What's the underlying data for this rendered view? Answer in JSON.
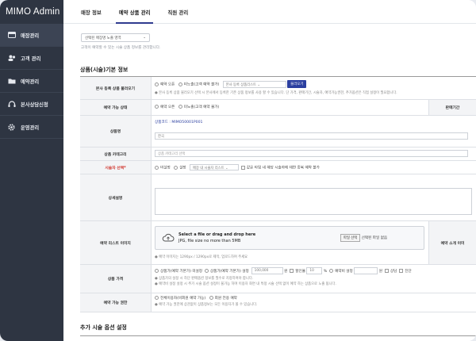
{
  "app": {
    "logo": "MIMO Admin"
  },
  "sidebar": {
    "items": [
      {
        "label": "매장관리",
        "icon": "store-icon",
        "active": true
      },
      {
        "label": "고객 관리",
        "icon": "users-icon"
      },
      {
        "label": "예약관리",
        "icon": "folder-icon"
      },
      {
        "label": "본사상담신청",
        "icon": "headset-icon"
      },
      {
        "label": "운영관리",
        "icon": "gear-icon"
      }
    ]
  },
  "tabs": [
    {
      "label": "매장 정보"
    },
    {
      "label": "예약 상품 관리",
      "active": true
    },
    {
      "label": "직원 관리"
    }
  ],
  "store_select": {
    "value": "선택된 매장명 노출 영역",
    "hint": "고객이 예약할 수 있는 시술 상품 정보를 관리합니다."
  },
  "section1": {
    "title": "상품(시술)기본 정보"
  },
  "rows": {
    "import": {
      "label": "본사 등록 상품 불러오기",
      "opt1": "예약 오픈",
      "opt2": "미노출(고객 예약 불가)",
      "select": "본사 등록 상품리스트",
      "button": "불러오기",
      "note": "본사 등록 상품 불러오기 선택 시 본사에서 등록한 기존 상품 정보를 사용 할 수 있습니다. 단 가격, 판매기간, 시술자, 예약가능권한, 추가옵션은 직접 설정이 필요합니다."
    },
    "status": {
      "label": "예약 가능 상태",
      "opt1": "예약 오픈",
      "opt2": "미노출(고객 예약 불가)",
      "right_label": "판매기간"
    },
    "name": {
      "label": "상품명",
      "code": "상품코드 : MIMO50001P001",
      "value": "한국"
    },
    "category": {
      "label": "상품 카테고리",
      "placeholder": "상품 카테고리 선택"
    },
    "staff": {
      "label": "시술자 선택*",
      "opt1": "미설정",
      "opt2": "설정",
      "select": "매장 내 시술자 리스트",
      "check": "같은 타임 내 해당 시술자에 대한 중복 예약 불가"
    },
    "detail": {
      "label": "상세설명"
    },
    "image": {
      "label": "예약 리스트 이미지",
      "upload_line1": "Select a file or drag and drop here",
      "upload_line2": "JPG, file size no more than 5MB",
      "button": "파일 선택",
      "file_status": "선택된 파일 없음",
      "note": "예약 이미지는 1290px / 1290px로 제작, 업로드하여 주세요",
      "right_label": "예약 소개 이미"
    },
    "price": {
      "label": "상품 가격",
      "opt1": "상품가(예약 기본가) 미설정",
      "opt2": "상품가(예약 기본가) 설정",
      "price_value": "100,000",
      "unit": "원",
      "discount_label": "할인율",
      "discount_value": "10",
      "pct": "%",
      "deposit_label": "예약비 설정",
      "won2": "원",
      "opt3": "상담",
      "opt4": "진단",
      "note1": "상품가의 설정 시 하단 판매옵션 정보를 필수로 지정하여야 합니다.",
      "note2": "예약비 설정 설정 시 추가 시술 옵션 설정이 불가능 하며 이용자 화면 내 특정 시술 선택 없이 예약 하는 상품으로 노출 됩니다."
    },
    "auth": {
      "label": "예약 가능 권한",
      "opt1": "전체이용자(비회원 예약 가능)",
      "opt2": "회원 전용 예약",
      "note": "예약 가능 권한에 상관없이 상품정보는 모든 이용자가 볼 수 있습니다."
    }
  },
  "section2": {
    "title": "추가 시술 옵션 설정"
  },
  "colors": {
    "sidebar": "#2e3542",
    "accent": "#2b3fa0"
  }
}
